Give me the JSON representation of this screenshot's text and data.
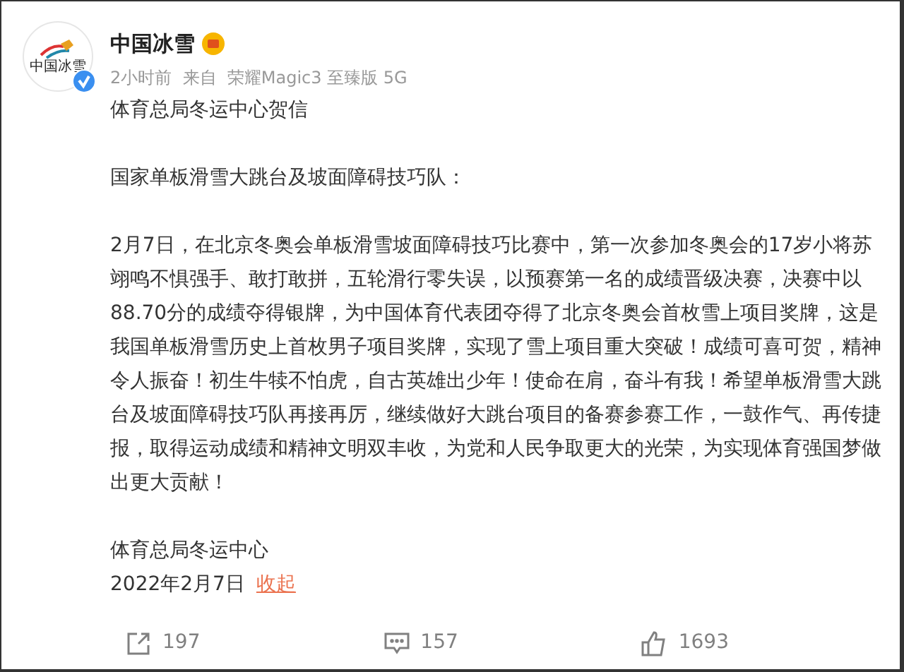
{
  "account": {
    "name": "中国冰雪",
    "verified": true,
    "avatar_text": "中国冰雪",
    "meta": "2小时前  来自  荣耀Magic3 至臻版 5G"
  },
  "post": {
    "title": "体育总局冬运中心贺信",
    "paragraphs": [
      "国家单板滑雪大跳台及坡面障碍技巧队：",
      "2月7日，在北京冬奥会单板滑雪坡面障碍技巧比赛中，第一次参加冬奥会的17岁小将苏翊鸣不惧强手、敢打敢拼，五轮滑行零失误，以预赛第一名的成绩晋级决赛，决赛中以88.70分的成绩夺得银牌，为中国体育代表团夺得了北京冬奥会首枚雪上项目奖牌，这是我国单板滑雪历史上首枚男子项目奖牌，实现了雪上项目重大突破！成绩可喜可贺，精神令人振奋！初生牛犊不怕虎，自古英雄出少年！使命在肩，奋斗有我！希望单板滑雪大跳台及坡面障碍技巧队再接再厉，继续做好大跳台项目的备赛参赛工作，一鼓作气、再传捷报，取得运动成绩和精神文明双丰收，为党和人民争取更大的光荣，为实现体育强国梦做出更大贡献！"
    ],
    "signature": "体育总局冬运中心",
    "date": "2022年2月7日",
    "collapse": "收起"
  },
  "actions": [
    {
      "kind": "share",
      "count": "197"
    },
    {
      "kind": "comment",
      "count": "157"
    },
    {
      "kind": "like",
      "count": "1693"
    }
  ]
}
